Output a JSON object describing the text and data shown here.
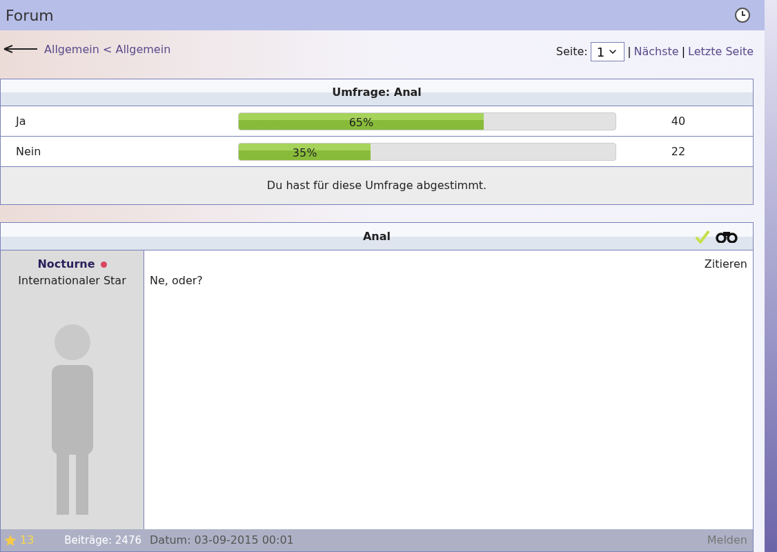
{
  "header": {
    "title": "Forum"
  },
  "breadcrumb": {
    "text": "Allgemein < Allgemein"
  },
  "pagination": {
    "label": "Seite:",
    "page": "1",
    "separator_1": "|",
    "next": "Nächste",
    "separator_2": "|",
    "last": "Letzte Seite"
  },
  "poll": {
    "title": "Umfrage: Anal",
    "options": [
      {
        "label": "Ja",
        "level": 0.65,
        "percent": "65%",
        "votes": "40"
      },
      {
        "label": "Nein",
        "level": 0.35,
        "percent": "35%",
        "votes": "22"
      }
    ],
    "footer": "Du hast für diese Umfrage abgestimmt."
  },
  "post": {
    "title": "Anal",
    "author": {
      "name": "Nocturne",
      "color": "#d9475f"
    },
    "rank": "Internationaler Star",
    "quote": "Zitieren",
    "body": "Ne, oder?",
    "stars_count": "13",
    "posts": "Beiträge: 2476",
    "date": "Datum: 03-09-2015 00:01",
    "report": "Melden"
  }
}
